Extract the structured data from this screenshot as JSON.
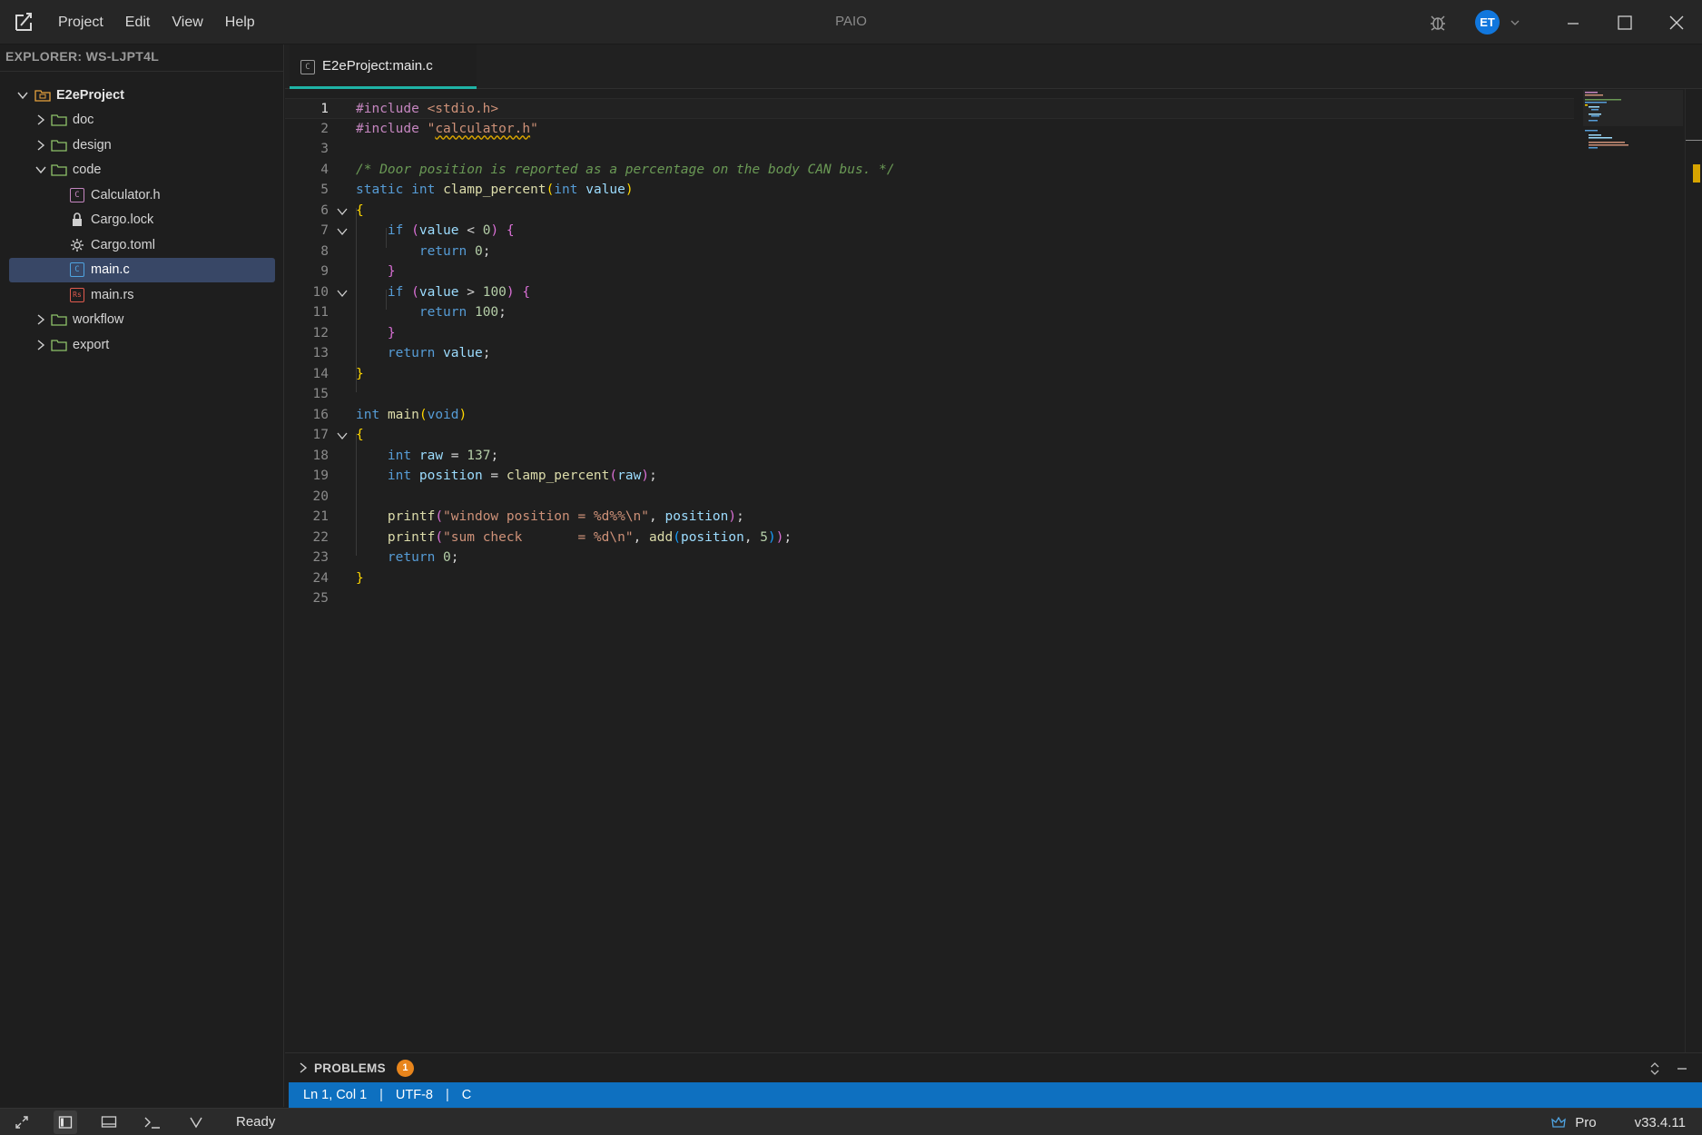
{
  "app": {
    "title": "PAIO",
    "menu": [
      "Project",
      "Edit",
      "View",
      "Help"
    ],
    "user_initials": "ET"
  },
  "sidebar": {
    "header": "EXPLORER: WS-LJPT4L",
    "tree": [
      {
        "label": "E2eProject",
        "type": "project",
        "expanded": true,
        "depth": 0
      },
      {
        "label": "doc",
        "type": "folder",
        "expanded": false,
        "depth": 1
      },
      {
        "label": "design",
        "type": "folder",
        "expanded": false,
        "depth": 1
      },
      {
        "label": "code",
        "type": "folder",
        "expanded": true,
        "depth": 1
      },
      {
        "label": "Calculator.h",
        "type": "c-file",
        "depth": 2
      },
      {
        "label": "Cargo.lock",
        "type": "lock-file",
        "depth": 2
      },
      {
        "label": "Cargo.toml",
        "type": "gear-file",
        "depth": 2
      },
      {
        "label": "main.c",
        "type": "c-file",
        "depth": 2,
        "selected": true
      },
      {
        "label": "main.rs",
        "type": "rs-file",
        "depth": 2
      },
      {
        "label": "workflow",
        "type": "folder",
        "expanded": false,
        "depth": 1
      },
      {
        "label": "export",
        "type": "folder",
        "expanded": false,
        "depth": 1
      }
    ]
  },
  "editor": {
    "tab_label": "E2eProject:main.c",
    "line_numbers": [
      "1",
      "2",
      "3",
      "4",
      "5",
      "6",
      "7",
      "8",
      "9",
      "10",
      "11",
      "12",
      "13",
      "14",
      "15",
      "16",
      "17",
      "18",
      "19",
      "20",
      "21",
      "22",
      "23",
      "24",
      "25"
    ],
    "active_line": "1",
    "fold_lines": [
      "6",
      "7",
      "10",
      "17"
    ]
  },
  "problems": {
    "label": "PROBLEMS",
    "count": "1"
  },
  "status": {
    "position": "Ln 1, Col 1",
    "encoding": "UTF-8",
    "language": "C"
  },
  "bottom": {
    "state": "Ready",
    "plan": "Pro",
    "version": "v33.4.11"
  },
  "colors": {
    "accent": "#0e70c0",
    "tab_underline": "#1fb3a6",
    "warning": "#e8851c",
    "avatar": "#1177dd"
  }
}
